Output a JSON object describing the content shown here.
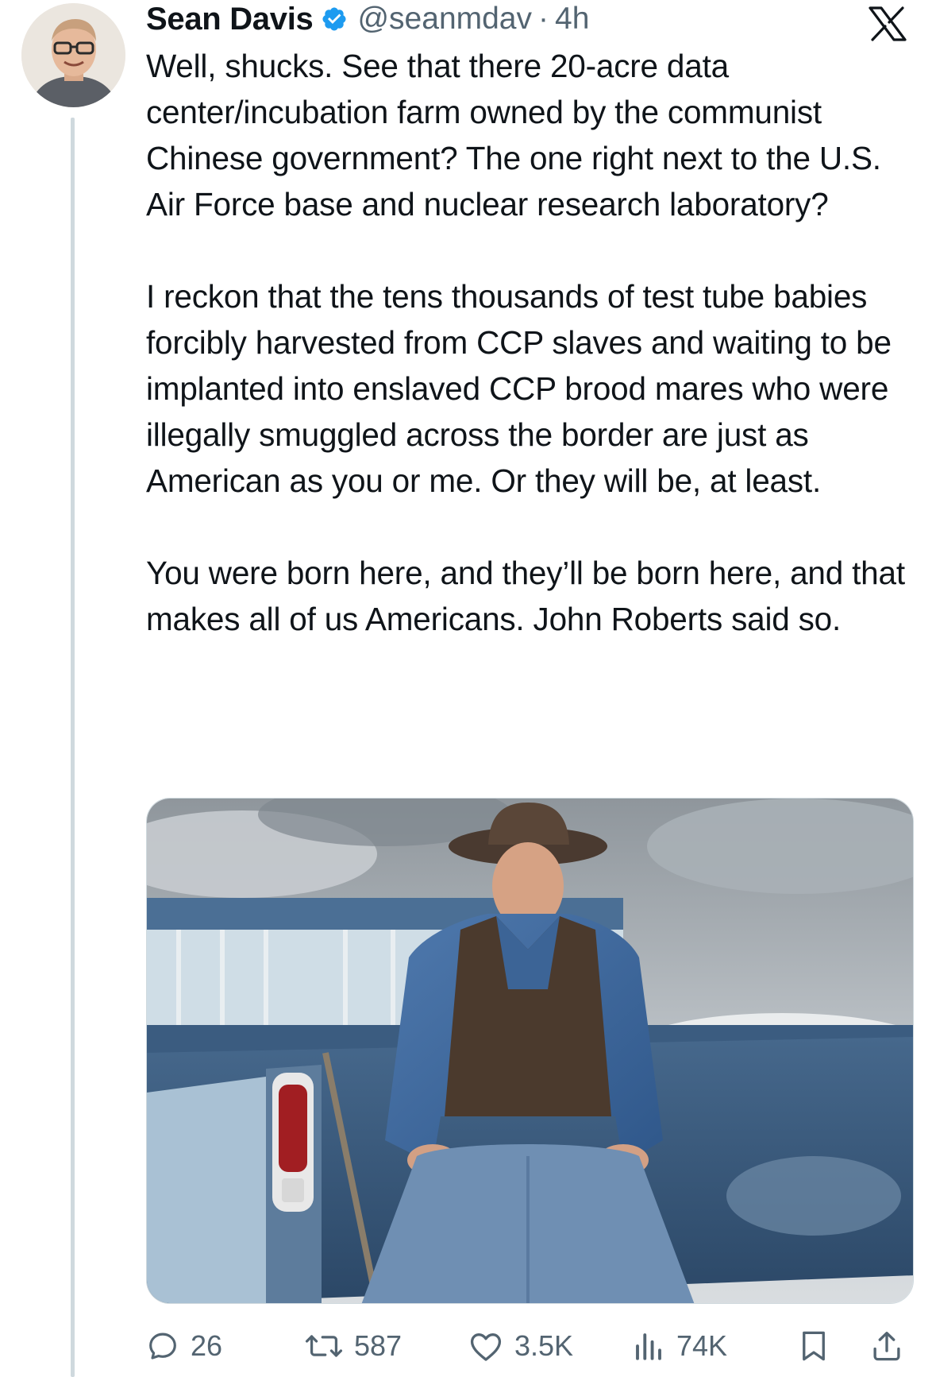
{
  "tweet": {
    "author": {
      "display_name": "Sean Davis",
      "handle": "@seanmdav",
      "separator": "·",
      "time": "4h",
      "verified": true
    },
    "paragraphs": [
      "Well, shucks. See that there 20-acre data center/incubation farm owned by the communist Chinese government? The one right next to the U.S. Air Force base and nuclear research laboratory?",
      "I reckon that the tens thousands of test tube babies forcibly harvested from CCP slaves and waiting to be implanted into enslaved CCP brood mares who were illegally smuggled across the border are just as American as you or me. Or they will be, at least.",
      "You were born here, and they’ll be born here, and that makes all of us Americans. John Roberts said so."
    ],
    "media": {
      "icon": "photo-of-man-in-cowboy-hat-on-pickup-truck"
    },
    "stats": {
      "replies": "26",
      "reposts": "587",
      "likes": "3.5K",
      "views": "74K"
    }
  },
  "icons": {
    "platform_logo": "x-logo-icon",
    "verified": "verified-badge-icon",
    "reply": "reply-icon",
    "repost": "repost-icon",
    "like": "like-icon",
    "views": "views-icon",
    "bookmark": "bookmark-icon",
    "share": "share-icon"
  },
  "colors": {
    "text_primary": "#0f1419",
    "text_secondary": "#536471",
    "verified_blue": "#1d9bf0",
    "thread_line": "#cfd9de"
  }
}
